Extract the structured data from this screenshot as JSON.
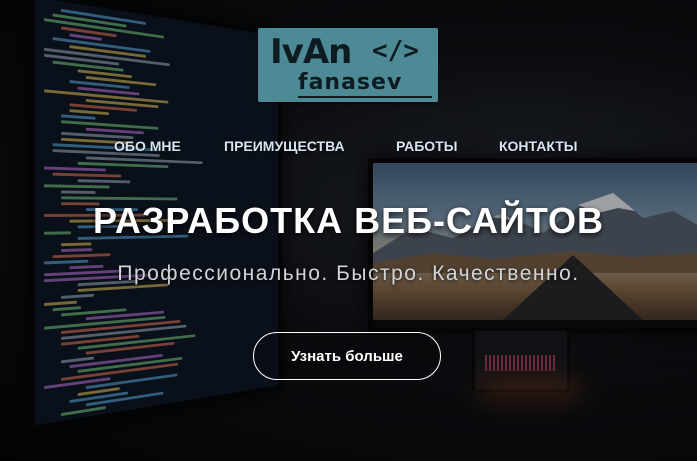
{
  "logo": {
    "line1": "IvAn",
    "code_symbol": "</>",
    "line2": "fanasev",
    "color": "#4e8a96"
  },
  "nav": {
    "items": [
      {
        "label": "ОБО МНЕ"
      },
      {
        "label": "ПРЕИМУЩЕСТВА"
      },
      {
        "label": "РАБОТЫ"
      },
      {
        "label": "КОНТАКТЫ"
      }
    ]
  },
  "hero": {
    "title": "РАЗРАБОТКА ВЕБ-САЙТОВ",
    "subtitle": "Профессионально. Быстро. Качественно.",
    "cta_label": "Узнать больше"
  }
}
